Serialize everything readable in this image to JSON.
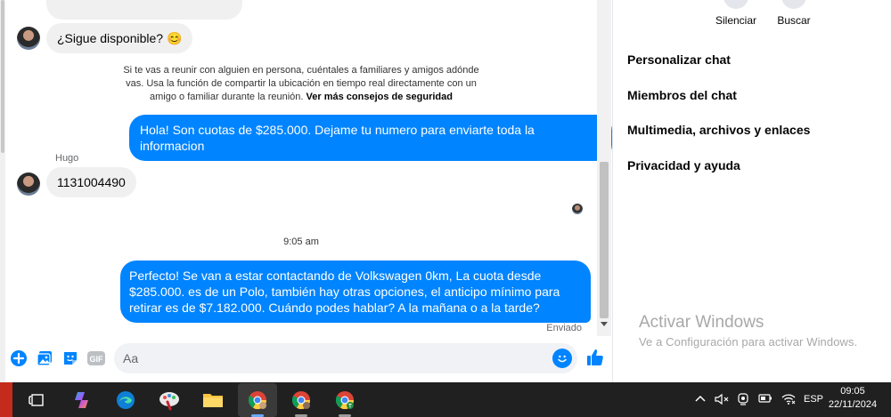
{
  "messages": {
    "q1": "¿Sigue disponible? 😊",
    "notice_text": "Si te vas a reunir con alguien en persona, cuéntales a familiares y amigos adónde vas. Usa la función de compartir la ubicación en tiempo real directamente con un amigo o familiar durante la reunión.",
    "notice_link": "Ver más consejos de seguridad",
    "out1": "Hola! Son cuotas de $285.000. Dejame tu numero para enviarte toda la informacion",
    "sender": "Hugo",
    "in2": "1131004490",
    "timestamp": "9:05 am",
    "out2": "Perfecto!  Se van a estar contactando de Volkswagen 0km, La cuota desde $285.000. es de un Polo, también hay otras opciones, el anticipo mínimo para retirar es de $7.182.000. Cuándo podes hablar? A la mañana o a la tarde?",
    "status": "Enviado"
  },
  "composer": {
    "placeholder": "Aa"
  },
  "panel": {
    "mute_label": "Silenciar",
    "search_label": "Buscar",
    "items": [
      "Personalizar chat",
      "Miembros del chat",
      "Multimedia, archivos y enlaces",
      "Privacidad y ayuda"
    ]
  },
  "watermark": {
    "title": "Activar Windows",
    "subtitle": "Ve a Configuración para activar Windows."
  },
  "taskbar": {
    "language": "ESP",
    "time": "09:05",
    "date": "22/11/2024"
  },
  "colors": {
    "accent": "#0084ff",
    "incoming_bubble": "#f0f0f0",
    "taskbar": "#202020"
  }
}
